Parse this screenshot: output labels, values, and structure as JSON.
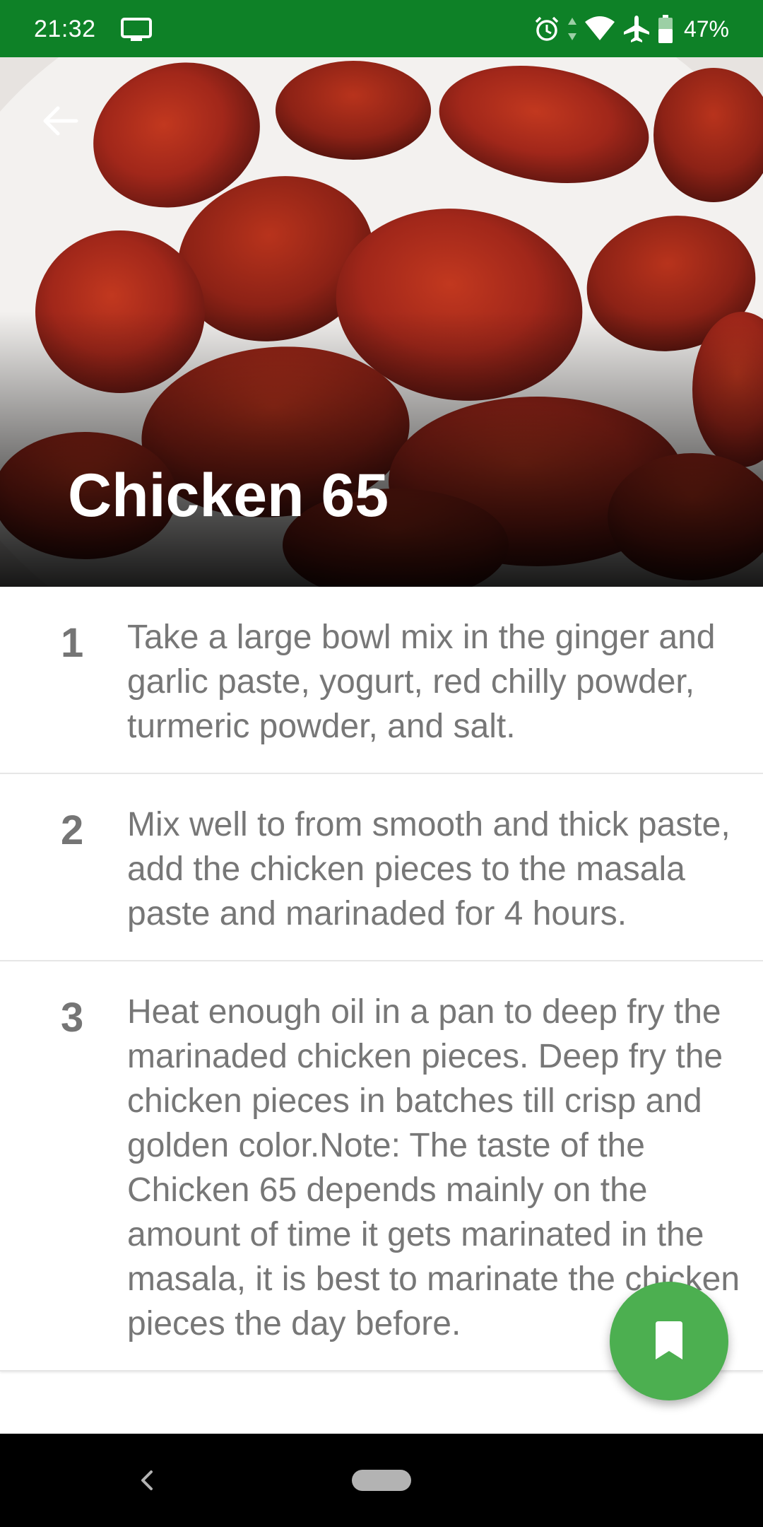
{
  "status_bar": {
    "time": "21:32",
    "battery": "47%",
    "icons": [
      "screen-cast-icon",
      "alarm-icon",
      "data-arrows-icon",
      "wifi-icon",
      "airplane-icon",
      "battery-icon"
    ]
  },
  "recipe": {
    "title": "Chicken 65",
    "steps": [
      {
        "number": "1",
        "text": "Take a large bowl mix in the ginger and garlic paste, yogurt, red chilly powder, turmeric powder, and salt."
      },
      {
        "number": "2",
        "text": "Mix well to from smooth and thick paste, add the chicken pieces to the masala paste and  marinaded for 4 hours."
      },
      {
        "number": "3",
        "text": "Heat enough oil in a pan to deep fry the marinaded chicken pieces. Deep fry the chicken pieces in batches till crisp and golden color.Note: The taste of the Chicken 65 depends mainly on the amount of time it gets marinated in the masala, it is best to marinate the chicken pieces the day before."
      }
    ]
  },
  "icons": {
    "back": "arrow-left-icon",
    "fab": "bookmark-icon",
    "nav_back": "chevron-left-icon",
    "nav_home": "home-pill-icon"
  },
  "colors": {
    "status_bar": "#0e8127",
    "fab": "#4caf50",
    "step_text": "#777777",
    "nav_bar": "#000000"
  }
}
